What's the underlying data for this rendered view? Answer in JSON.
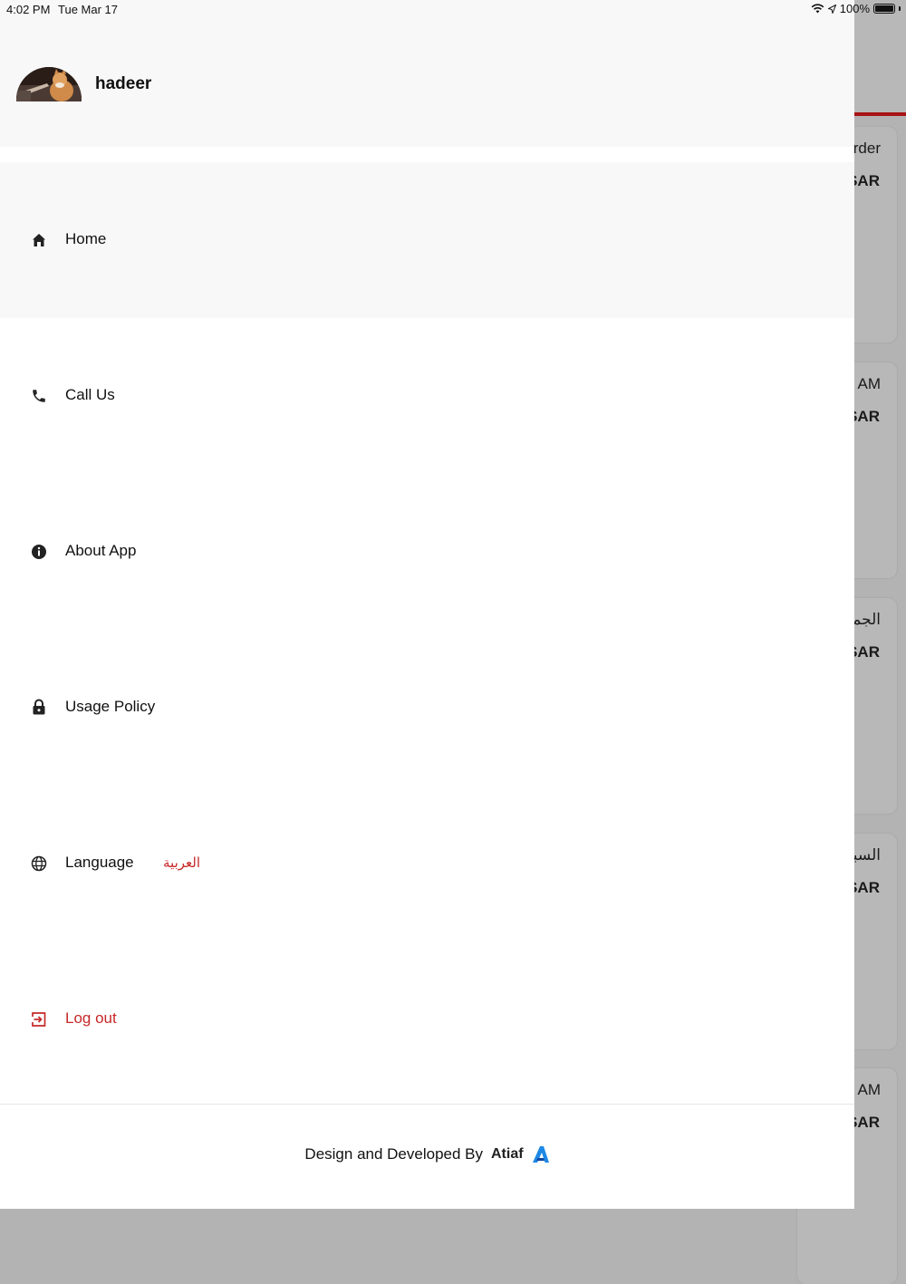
{
  "status_bar": {
    "time": "4:02 PM",
    "date": "Tue Mar 17",
    "battery": "100%"
  },
  "drawer": {
    "user_name": "hadeer",
    "menu": [
      {
        "label": "Home",
        "icon": "home-icon"
      },
      {
        "label": "Call Us",
        "icon": "phone-icon"
      },
      {
        "label": "About App",
        "icon": "info-icon"
      },
      {
        "label": "Usage Policy",
        "icon": "lock-icon"
      },
      {
        "label": "Language",
        "icon": "globe-icon",
        "value": "العربية"
      },
      {
        "label": "Log out",
        "icon": "logout-icon"
      }
    ],
    "footer": {
      "text": "Design and Developed By",
      "brand": "Atiaf"
    }
  },
  "background": {
    "cards": [
      {
        "line1": "rder",
        "line2": "SAR"
      },
      {
        "line1": "AM",
        "line2": "SAR"
      },
      {
        "line1": "الجمعة",
        "line2": "SAR"
      },
      {
        "line1": "السبت",
        "line2": "SAR"
      },
      {
        "line1": "AM",
        "line2": "SAR"
      }
    ]
  },
  "colors": {
    "accent_red": "#c62828",
    "brand_blue": "#1e88e5",
    "overlay_gray": "#b3b3b3"
  }
}
